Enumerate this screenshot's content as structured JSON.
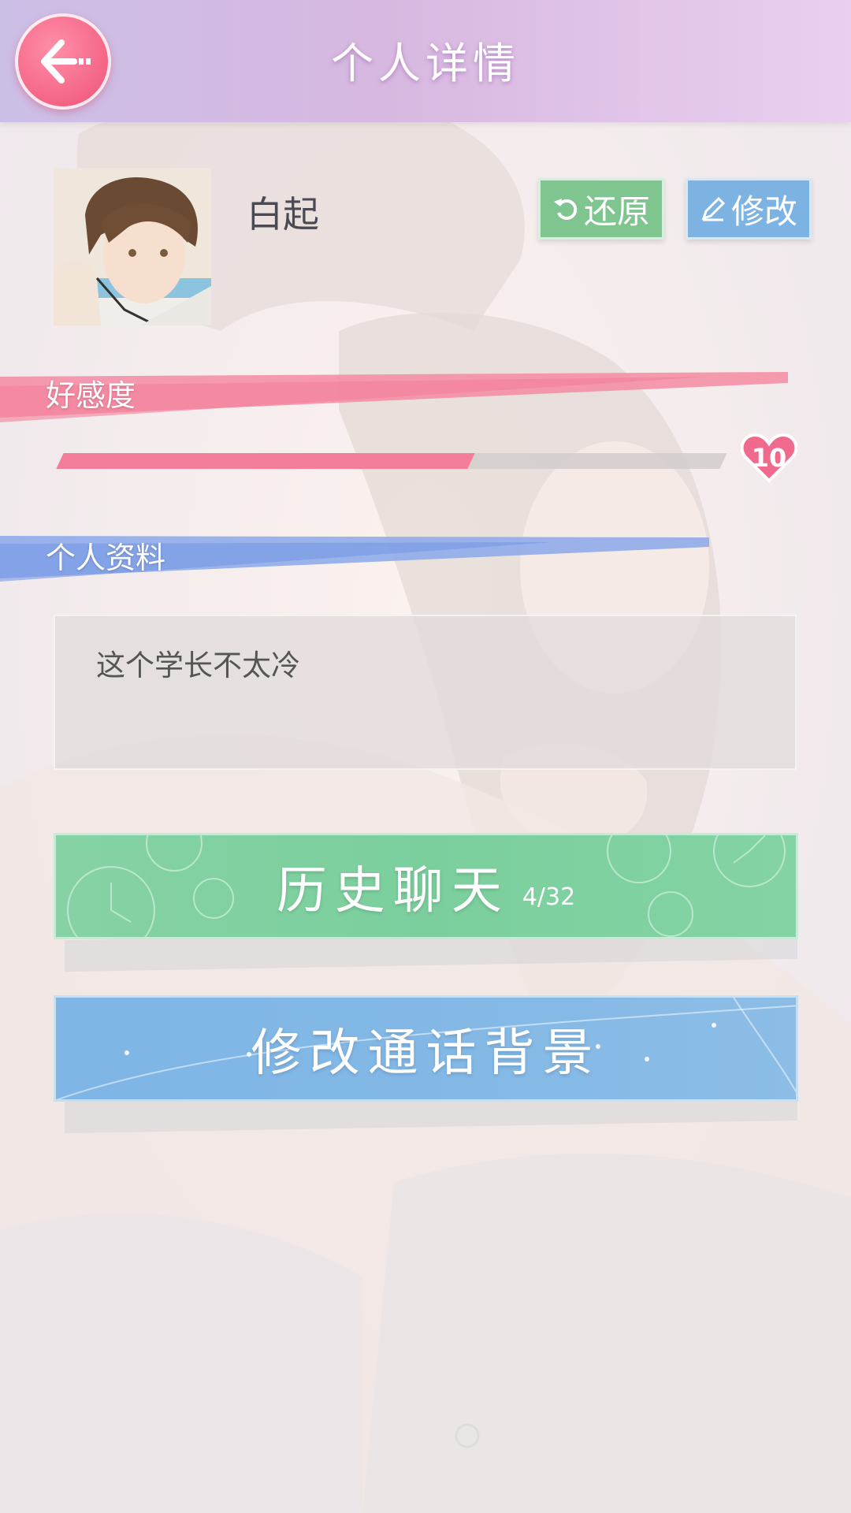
{
  "header": {
    "title": "个人详情",
    "back_icon": "back-arrow-icon"
  },
  "profile": {
    "name": "白起",
    "restore_label": "还原",
    "edit_label": "修改"
  },
  "affection": {
    "label": "好感度",
    "level": "10",
    "progress_fraction": 0.62,
    "accent": "#f47e9a"
  },
  "info": {
    "label": "个人资料",
    "bio": "这个学长不太冷"
  },
  "actions": {
    "history_label": "历史聊天",
    "history_count": "4/32",
    "background_label": "修改通话背景"
  },
  "colors": {
    "header_gradient": [
      "#ccbfe6",
      "#eacff0"
    ],
    "restore_green": "#7ec58f",
    "edit_blue": "#7db3e3",
    "history_green": "#86d2a5",
    "background_blue": "#7fb6e6"
  }
}
